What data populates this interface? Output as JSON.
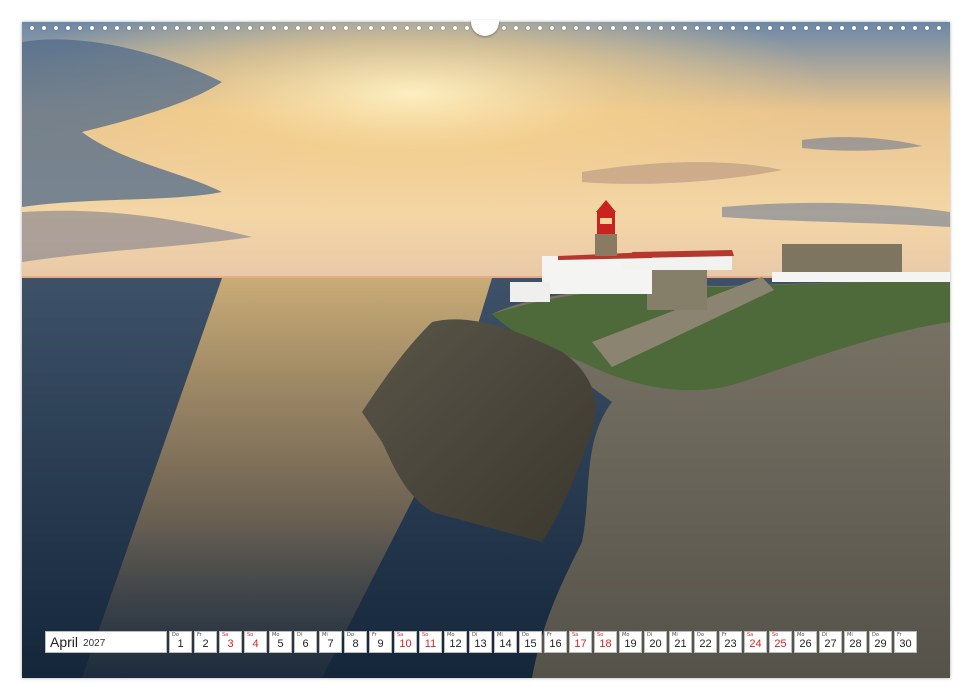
{
  "calendar": {
    "month": "April",
    "year": "2027",
    "days": [
      {
        "dow": "Do",
        "num": "1",
        "weekend": false
      },
      {
        "dow": "Fr",
        "num": "2",
        "weekend": false
      },
      {
        "dow": "Sa",
        "num": "3",
        "weekend": true
      },
      {
        "dow": "So",
        "num": "4",
        "weekend": true
      },
      {
        "dow": "Mo",
        "num": "5",
        "weekend": false
      },
      {
        "dow": "Di",
        "num": "6",
        "weekend": false
      },
      {
        "dow": "Mi",
        "num": "7",
        "weekend": false
      },
      {
        "dow": "Do",
        "num": "8",
        "weekend": false
      },
      {
        "dow": "Fr",
        "num": "9",
        "weekend": false
      },
      {
        "dow": "Sa",
        "num": "10",
        "weekend": true
      },
      {
        "dow": "So",
        "num": "11",
        "weekend": true
      },
      {
        "dow": "Mo",
        "num": "12",
        "weekend": false
      },
      {
        "dow": "Di",
        "num": "13",
        "weekend": false
      },
      {
        "dow": "Mi",
        "num": "14",
        "weekend": false
      },
      {
        "dow": "Do",
        "num": "15",
        "weekend": false
      },
      {
        "dow": "Fr",
        "num": "16",
        "weekend": false
      },
      {
        "dow": "Sa",
        "num": "17",
        "weekend": true
      },
      {
        "dow": "So",
        "num": "18",
        "weekend": true
      },
      {
        "dow": "Mo",
        "num": "19",
        "weekend": false
      },
      {
        "dow": "Di",
        "num": "20",
        "weekend": false
      },
      {
        "dow": "Mi",
        "num": "21",
        "weekend": false
      },
      {
        "dow": "Do",
        "num": "22",
        "weekend": false
      },
      {
        "dow": "Fr",
        "num": "23",
        "weekend": false
      },
      {
        "dow": "Sa",
        "num": "24",
        "weekend": true
      },
      {
        "dow": "So",
        "num": "25",
        "weekend": true
      },
      {
        "dow": "Mo",
        "num": "26",
        "weekend": false
      },
      {
        "dow": "Di",
        "num": "27",
        "weekend": false
      },
      {
        "dow": "Mi",
        "num": "28",
        "weekend": false
      },
      {
        "dow": "Do",
        "num": "29",
        "weekend": false
      },
      {
        "dow": "Fr",
        "num": "30",
        "weekend": false
      }
    ]
  },
  "colors": {
    "weekend": "#dd2222",
    "sea": "#1e3448",
    "sky_glow": "#f7d79a",
    "lighthouse_red": "#c8231e"
  }
}
